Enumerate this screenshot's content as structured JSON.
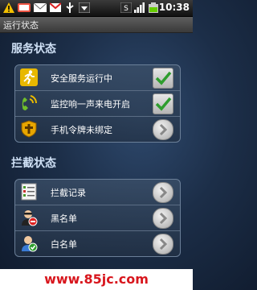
{
  "status_bar": {
    "time": "10:38"
  },
  "app": {
    "title": "运行状态"
  },
  "sections": [
    {
      "title": "服务状态",
      "items": [
        {
          "label": "安全服务运行中",
          "icon": "runner-icon",
          "control": "checkbox",
          "checked": true
        },
        {
          "label": "监控响一声来电开启",
          "icon": "phone-wave-icon",
          "control": "checkbox",
          "checked": true
        },
        {
          "label": "手机令牌未绑定",
          "icon": "token-shield-icon",
          "control": "arrow"
        }
      ]
    },
    {
      "title": "拦截状态",
      "items": [
        {
          "label": "拦截记录",
          "icon": "log-list-icon",
          "control": "arrow"
        },
        {
          "label": "黑名单",
          "icon": "blacklist-user-icon",
          "control": "arrow"
        },
        {
          "label": "白名单",
          "icon": "whitelist-user-icon",
          "control": "arrow"
        }
      ]
    }
  ],
  "watermark": "www.85jc.com",
  "colors": {
    "accent_green": "#2e9d2e",
    "watermark_red": "#d8161d"
  }
}
